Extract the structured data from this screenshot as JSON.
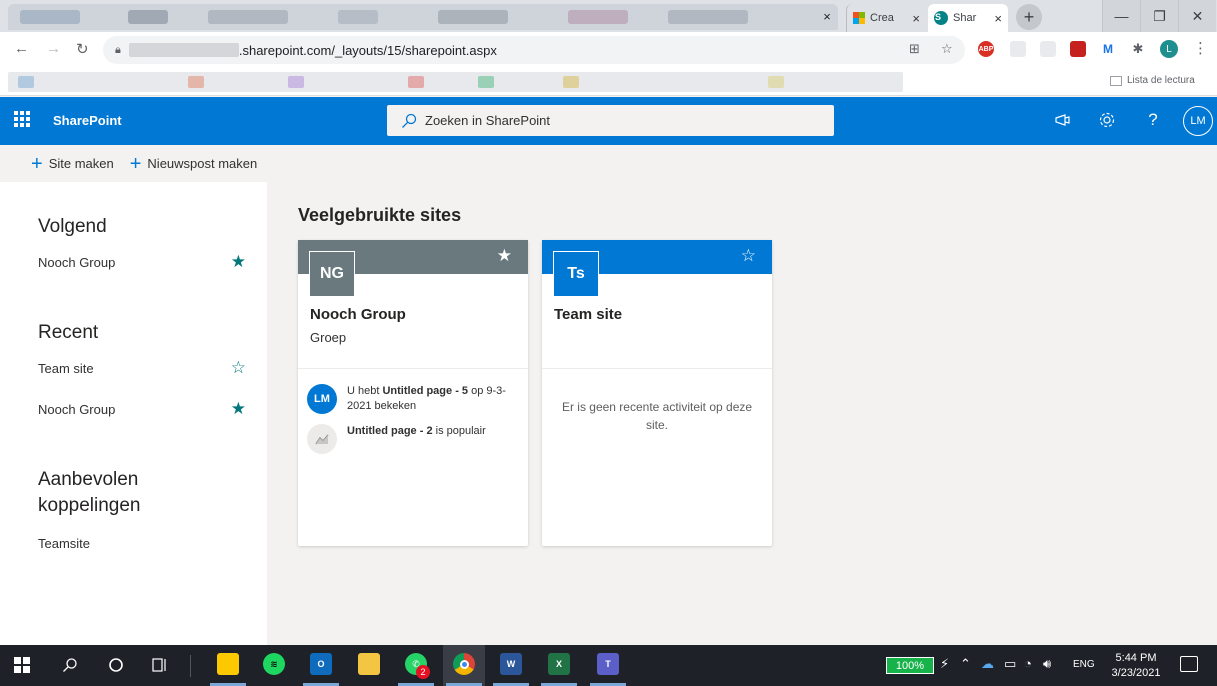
{
  "browser": {
    "tab_ms_title": "Crea",
    "tab_sp_title": "Shar",
    "tab_close": "×",
    "new_tab": "+",
    "url": ".sharepoint.com/_layouts/15/sharepoint.aspx",
    "reading_list": "Lista de lectura",
    "profile_initial": "L",
    "ext_abp": "ABP",
    "window_minimize": "—",
    "window_restore": "❐",
    "window_close": "✕"
  },
  "suite": {
    "brand": "SharePoint",
    "search_placeholder": "Zoeken in SharePoint",
    "help": "?",
    "avatar": "LM"
  },
  "commands": {
    "create_site": "Site maken",
    "create_news": "Nieuwspost maken"
  },
  "leftnav": {
    "following_heading": "Volgend",
    "following": [
      {
        "label": "Nooch Group",
        "starred": true
      }
    ],
    "recent_heading": "Recent",
    "recent": [
      {
        "label": "Team site",
        "starred": false
      },
      {
        "label": "Nooch Group",
        "starred": true
      }
    ],
    "recommended_heading_1": "Aanbevolen",
    "recommended_heading_2": "koppelingen",
    "recommended": [
      {
        "label": "Teamsite"
      }
    ]
  },
  "main": {
    "title": "Veelgebruikte sites",
    "cards": [
      {
        "initials": "NG",
        "name": "Nooch Group",
        "type": "Groep",
        "banner_color": "#69797e",
        "starred": true,
        "activity": [
          {
            "icon_text": "LM",
            "prefix": "U hebt ",
            "bold": "Untitled page - 5",
            "suffix": " op 9-3-2021 bekeken"
          },
          {
            "icon_text": "",
            "prefix": "",
            "bold": "Untitled page - 2",
            "suffix": " is populair"
          }
        ]
      },
      {
        "initials": "Ts",
        "name": "Team site",
        "type": "",
        "banner_color": "#0078d4",
        "starred": false,
        "empty_message": "Er is geen recente activiteit op deze site."
      }
    ]
  },
  "taskbar": {
    "battery": "100%",
    "language": "ENG",
    "time": "5:44 PM",
    "date": "3/23/2021",
    "whatsapp_badge": "2"
  }
}
